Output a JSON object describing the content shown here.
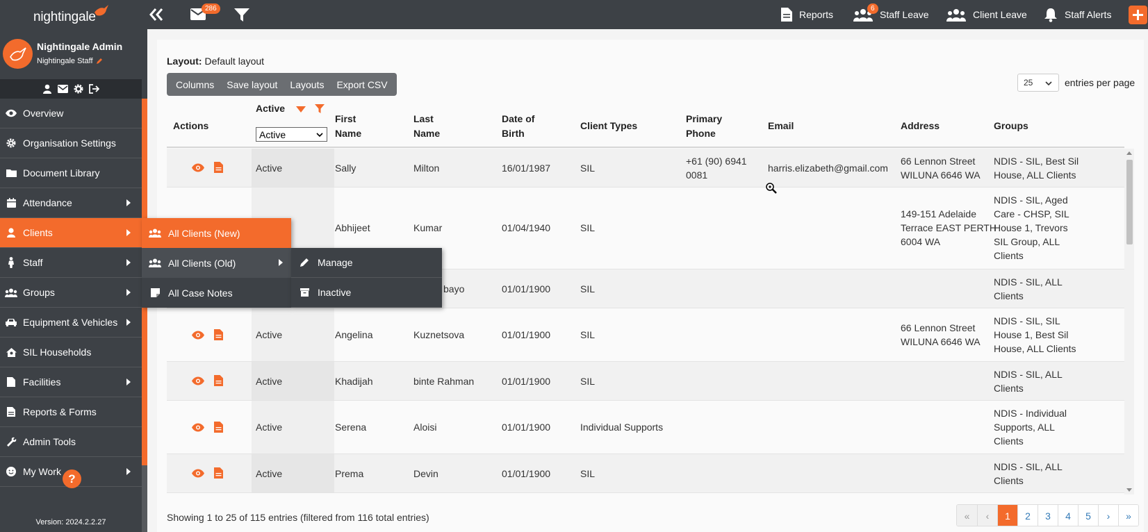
{
  "brand": {
    "logo_text": "nightingale"
  },
  "topbar": {
    "mail_count": "286",
    "staff_leave_count": "6",
    "reports": "Reports",
    "staff_leave": "Staff Leave",
    "client_leave": "Client Leave",
    "staff_alerts": "Staff Alerts"
  },
  "profile": {
    "name": "Nightingale Admin",
    "role": "Nightingale Staff"
  },
  "sidebar": {
    "items": [
      {
        "label": "Overview",
        "icon": "eye-icon"
      },
      {
        "label": "Organisation Settings",
        "icon": "gear-icon"
      },
      {
        "label": "Document Library",
        "icon": "folder-icon"
      },
      {
        "label": "Attendance",
        "icon": "calendar-icon"
      },
      {
        "label": "Clients",
        "icon": "user-icon"
      },
      {
        "label": "Staff",
        "icon": "person-icon"
      },
      {
        "label": "Groups",
        "icon": "users-icon"
      },
      {
        "label": "Equipment & Vehicles",
        "icon": "car-icon"
      },
      {
        "label": "SIL Households",
        "icon": "house-icon"
      },
      {
        "label": "Facilities",
        "icon": "building-icon"
      },
      {
        "label": "Reports & Forms",
        "icon": "file-icon"
      },
      {
        "label": "Admin Tools",
        "icon": "wrench-icon"
      },
      {
        "label": "My Work",
        "icon": "smile-icon"
      }
    ],
    "help": "?",
    "version": "Version: 2024.2.2.27"
  },
  "clients_menu": {
    "items": [
      {
        "label": "All Clients (New)"
      },
      {
        "label": "All Clients (Old)"
      },
      {
        "label": "All Case Notes"
      }
    ]
  },
  "clients_old_menu": {
    "items": [
      {
        "label": "Manage"
      },
      {
        "label": "Inactive"
      }
    ]
  },
  "layout": {
    "label": "Layout:",
    "value": "Default layout"
  },
  "toolbar": {
    "columns": "Columns",
    "save_layout": "Save layout",
    "layouts": "Layouts",
    "export_csv": "Export CSV"
  },
  "entries": {
    "value": "25",
    "label": "entries per page"
  },
  "table": {
    "headers": {
      "actions": "Actions",
      "active": "Active",
      "active_filter": "Active",
      "first_name_1": "First",
      "first_name_2": "Name",
      "last_name_1": "Last",
      "last_name_2": "Name",
      "dob_1": "Date of",
      "dob_2": "Birth",
      "client_types": "Client Types",
      "phone_1": "Primary",
      "phone_2": "Phone",
      "email": "Email",
      "address": "Address",
      "groups": "Groups"
    },
    "rows": [
      {
        "status": "Active",
        "first": "Sally",
        "last": "Milton",
        "dob": "16/01/1987",
        "types": "SIL",
        "phone_1": "+61 (90) 6941",
        "phone_2": "0081",
        "email": "harris.elizabeth@gmail.com",
        "addr_1": "66 Lennon Street",
        "addr_2": "WILUNA 6646 WA",
        "addr_3": "",
        "groups_1": "NDIS - SIL, Best Sil",
        "groups_2": "House, ALL Clients",
        "groups_3": "",
        "groups_4": "",
        "groups_5": ""
      },
      {
        "status": "",
        "first": "Abhijeet",
        "last": "Kumar",
        "dob": "01/04/1940",
        "types": "SIL",
        "phone_1": "",
        "phone_2": "",
        "email": "",
        "addr_1": "149-151 Adelaide",
        "addr_2": "Terrace EAST PERTH",
        "addr_3": "6004 WA",
        "groups_1": "NDIS - SIL, Aged",
        "groups_2": "Care - CHSP, SIL",
        "groups_3": "House 1, Trevors",
        "groups_4": "SIL Group, ALL",
        "groups_5": "Clients"
      },
      {
        "status": "",
        "first": "",
        "last": "bayo",
        "dob": "01/01/1900",
        "types": "SIL",
        "phone_1": "",
        "phone_2": "",
        "email": "",
        "addr_1": "",
        "addr_2": "",
        "addr_3": "",
        "groups_1": "NDIS - SIL, ALL",
        "groups_2": "Clients",
        "groups_3": "",
        "groups_4": "",
        "groups_5": ""
      },
      {
        "status": "Active",
        "first": "Angelina",
        "last": "Kuznetsova",
        "dob": "01/01/1900",
        "types": "SIL",
        "phone_1": "",
        "phone_2": "",
        "email": "",
        "addr_1": "66 Lennon Street",
        "addr_2": "WILUNA 6646 WA",
        "addr_3": "",
        "groups_1": "NDIS - SIL, SIL",
        "groups_2": "House 1, Best Sil",
        "groups_3": "House, ALL Clients",
        "groups_4": "",
        "groups_5": ""
      },
      {
        "status": "Active",
        "first": "Khadijah",
        "last": "binte Rahman",
        "dob": "01/01/1900",
        "types": "SIL",
        "phone_1": "",
        "phone_2": "",
        "email": "",
        "addr_1": "",
        "addr_2": "",
        "addr_3": "",
        "groups_1": "NDIS - SIL, ALL",
        "groups_2": "Clients",
        "groups_3": "",
        "groups_4": "",
        "groups_5": ""
      },
      {
        "status": "Active",
        "first": "Serena",
        "last": "Aloisi",
        "dob": "01/01/1900",
        "types": "Individual Supports",
        "phone_1": "",
        "phone_2": "",
        "email": "",
        "addr_1": "",
        "addr_2": "",
        "addr_3": "",
        "groups_1": "NDIS - Individual",
        "groups_2": "Supports, ALL",
        "groups_3": "Clients",
        "groups_4": "",
        "groups_5": ""
      },
      {
        "status": "Active",
        "first": "Prema",
        "last": "Devin",
        "dob": "01/01/1900",
        "types": "SIL",
        "phone_1": "",
        "phone_2": "",
        "email": "",
        "addr_1": "",
        "addr_2": "",
        "addr_3": "",
        "groups_1": "NDIS - SIL, ALL",
        "groups_2": "Clients",
        "groups_3": "",
        "groups_4": "",
        "groups_5": ""
      }
    ]
  },
  "summary": "Showing 1 to 25 of 115 entries (filtered from 116 total entries)",
  "pagination": {
    "first": "«",
    "prev": "‹",
    "pages": [
      "1",
      "2",
      "3",
      "4",
      "5"
    ],
    "next": "›",
    "last": "»",
    "current": "1"
  },
  "colors": {
    "accent": "#f36b2c",
    "sidebar": "#3d4146",
    "topbar": "#3d4146"
  }
}
